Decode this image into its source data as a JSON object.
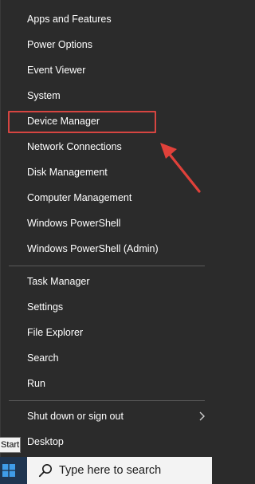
{
  "menu": {
    "items": [
      "Apps and Features",
      "Power Options",
      "Event Viewer",
      "System",
      "Device Manager",
      "Network Connections",
      "Disk Management",
      "Computer Management",
      "Windows PowerShell",
      "Windows PowerShell (Admin)",
      "Task Manager",
      "Settings",
      "File Explorer",
      "Search",
      "Run",
      "Shut down or sign out",
      "Desktop"
    ],
    "highlighted_item": "Device Manager",
    "highlight_color": "#d64541",
    "arrow_color": "#e0413a"
  },
  "tooltip": {
    "label": "Start"
  },
  "taskbar": {
    "search_placeholder": "Type here to search",
    "search_icon": "search-icon",
    "start_icon": "windows-logo-icon"
  }
}
